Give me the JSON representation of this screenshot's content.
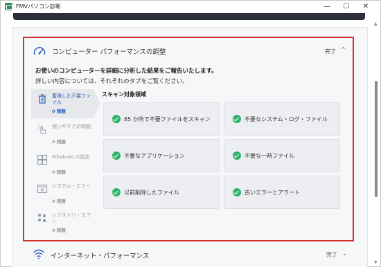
{
  "window": {
    "title": "FMVパソコン診断",
    "minimize": "—",
    "maximize": "☐",
    "close": "✕"
  },
  "section": {
    "title": "コンピューター パフォーマンスの調整",
    "status": "完了",
    "chevron": "^",
    "icon": "speed-gauge-icon"
  },
  "intro": {
    "line1": "お使いのコンピューターを詳細に分析した結果をご報告いたします。",
    "line2": "詳しい内容については、それぞれのタブをご覧ください。"
  },
  "tabs": [
    {
      "label": "蓄積した不要ファイル",
      "count": "0 問題",
      "icon": "trash-icon",
      "active": true
    },
    {
      "label": "使いやすさの問題",
      "count": "0 問題",
      "icon": "hand-pointer-icon",
      "active": false
    },
    {
      "label": "Windows の設定",
      "count": "0 問題",
      "icon": "windows-icon",
      "active": false
    },
    {
      "label": "システム・エラー",
      "count": "0 問題",
      "icon": "error-window-icon",
      "active": false
    },
    {
      "label": "レジストリ・エラー",
      "count": "0 問題",
      "icon": "registry-icon",
      "active": false
    }
  ],
  "scan": {
    "heading": "スキャン対象領域",
    "items": [
      "85 か所で不要ファイルをスキャン",
      "不要なシステム・ログ・ファイル",
      "不要なアプリケーション",
      "不要な一時ファイル",
      "以前削除したファイル",
      "古いエラーとアラート"
    ]
  },
  "next_section": {
    "title": "インターネット・パフォーマンス",
    "status": "完了",
    "chevron": "⌄",
    "icon": "wifi-icon"
  },
  "colors": {
    "highlight_border": "#d42b2b",
    "active_tab": "#2a62b8",
    "check": "#2fb36a"
  }
}
